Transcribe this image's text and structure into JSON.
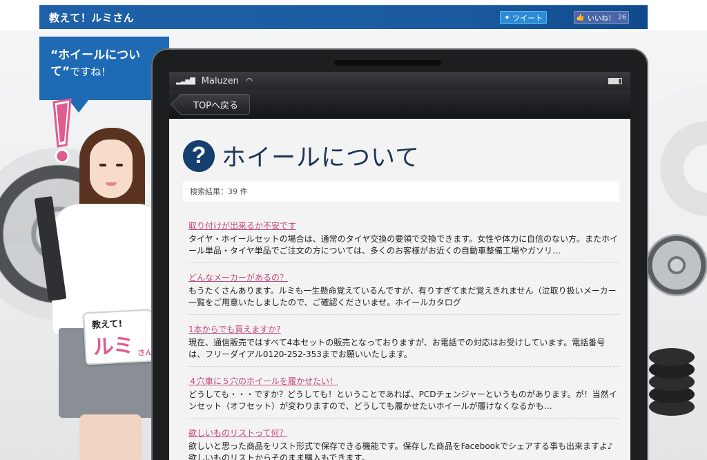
{
  "header": {
    "title": "教えて！ルミさん",
    "tweet_label": "ツイート",
    "like_label": "いいね！",
    "like_count": "26"
  },
  "bubble": {
    "quote": "“ホイールについて”",
    "suffix": "ですね！"
  },
  "badge": {
    "top": "教えて!",
    "main": "ルミ",
    "sub": "さん"
  },
  "tablet": {
    "carrier": "Maluzen",
    "back_label": "TOPへ戻る"
  },
  "page": {
    "title": "ホイールについて",
    "result": "検索結果：39 件"
  },
  "faq": [
    {
      "q": "取り付けが出来るか不安です",
      "a": "タイヤ・ホイールセットの場合は、通常のタイヤ交換の要領で交換できます。女性や体力に自信のない方。またホイール単品・タイヤ単品でご注文の方については、多くのお客様がお近くの自動車整備工場やガソリ…"
    },
    {
      "q": "どんなメーカーがあるの？",
      "a": "もうたくさんあります。ルミも一生懸命覚えているんですが、有りすぎてまだ覚えきれません（泣取り扱いメーカー一覧をご用意いたしましたので、ご確認くださいませ。ホイールカタログ"
    },
    {
      "q": "1本からでも買えますか?",
      "a": "現在、通信販売ではすべて4本セットの販売となっておりますが、お電話での対応はお受けしています。電話番号は、フリーダイアル0120-252-353までお願いいたします。"
    },
    {
      "q": "４穴車に５穴のホイールを履かせたい！",
      "a": "どうしても・・・ですか？どうしても！ということであれば、PCDチェンジャーというものがあります。が！当然インセット（オフセット）が変わりますので、どうしても履かせたいホイールが履けなくなるかも…"
    },
    {
      "q": "欲しいものリストって何？",
      "a": "欲しいと思った商品をリスト形式で保存できる機能です。保存した商品をFacebookでシェアする事も出来ますよ♪欲しいものリストからそのまま購入もできます。"
    }
  ],
  "colors": {
    "header_blue": "#1f61a8",
    "link_pink": "#c2477e",
    "title_navy": "#1b3657"
  }
}
